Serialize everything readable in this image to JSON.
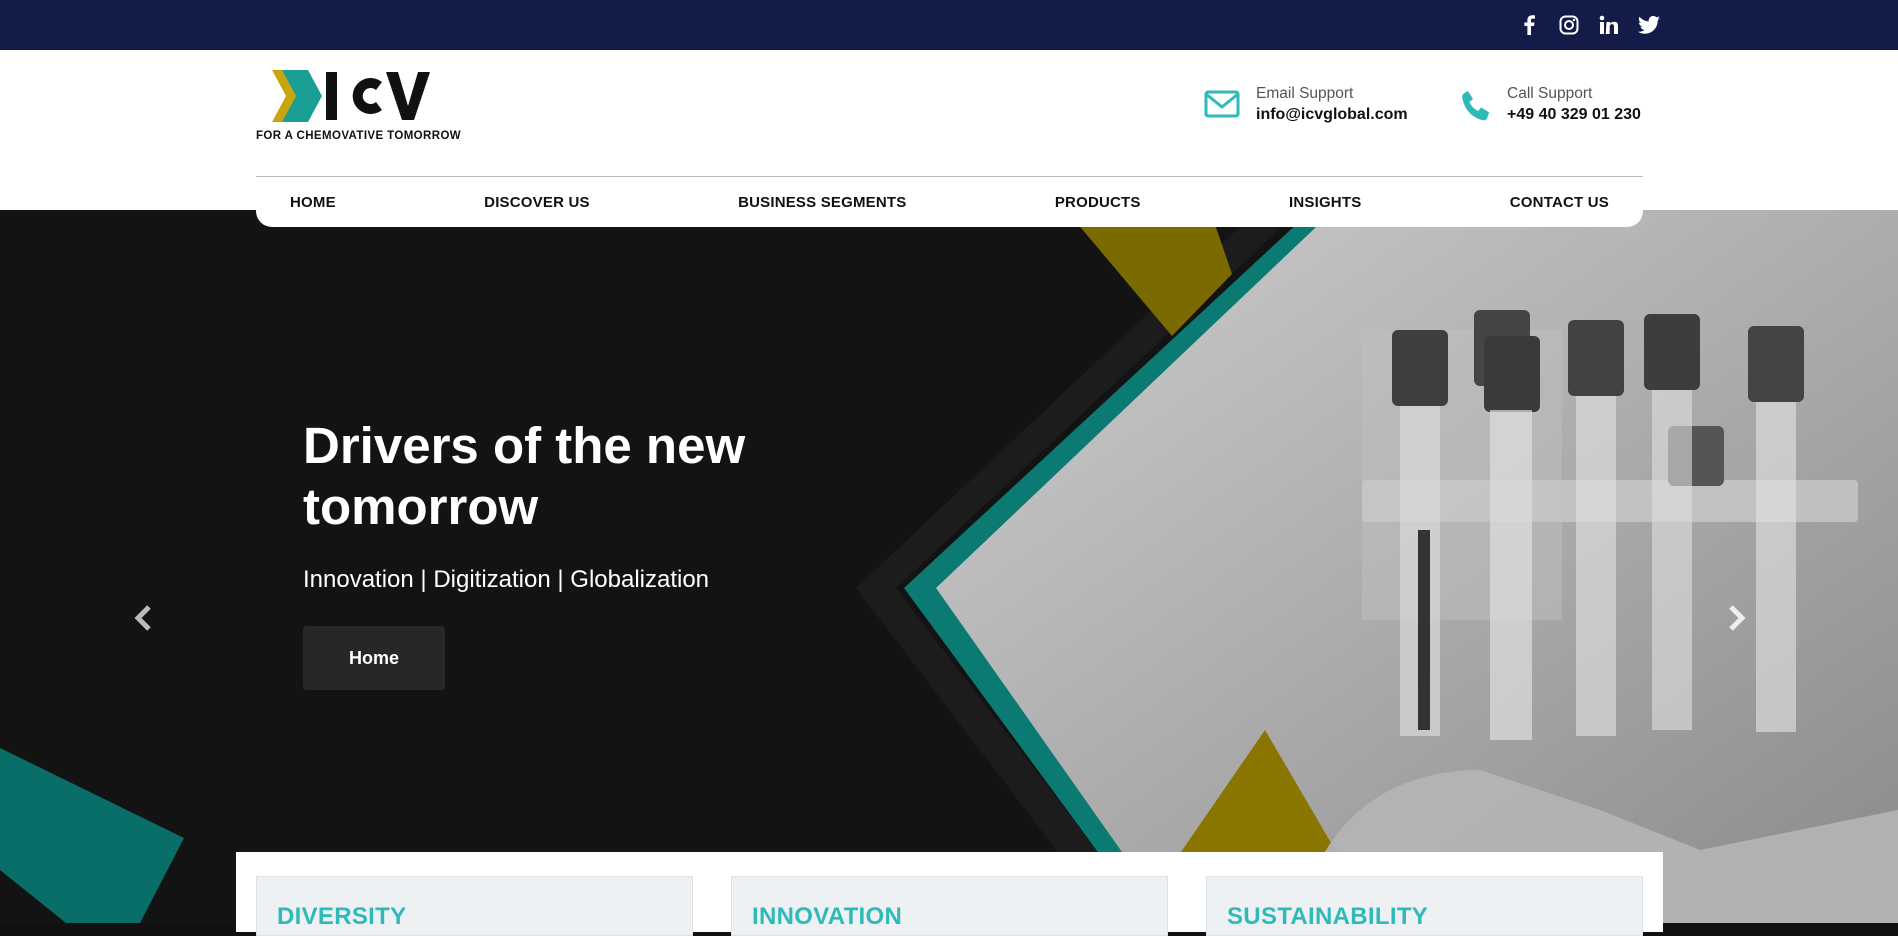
{
  "social": [
    "facebook-icon",
    "instagram-icon",
    "linkedin-icon",
    "twitter-icon"
  ],
  "logo": {
    "text": "ICV",
    "tagline": "FOR A CHEMOVATIVE TOMORROW"
  },
  "support": {
    "email": {
      "label": "Email Support",
      "value": "info@icvglobal.com"
    },
    "call": {
      "label": "Call Support",
      "value": "+49 40 329 01 230"
    }
  },
  "nav": [
    "HOME",
    "DISCOVER US",
    "BUSINESS SEGMENTS",
    "PRODUCTS",
    "INSIGHTS",
    "CONTACT US"
  ],
  "hero": {
    "title": "Drivers of the new tomorrow",
    "subtitle": "Innovation | Digitization | Globalization",
    "button": "Home"
  },
  "cards": [
    "DIVERSITY",
    "INNOVATION",
    "SUSTAINABILITY"
  ],
  "colors": {
    "topbar": "#131c48",
    "teal": "#2fbab8",
    "gold": "#d2b20c",
    "dark": "#131313"
  }
}
